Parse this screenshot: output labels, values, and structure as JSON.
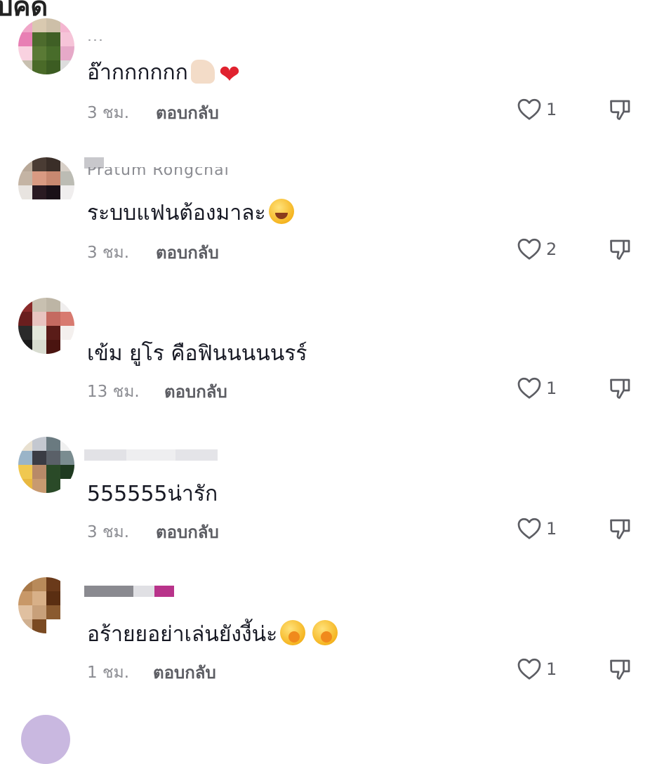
{
  "header": {
    "partial_title": "ปคิด"
  },
  "comments": [
    {
      "username": "...",
      "text": "อ๊ากกกกกก",
      "emojis": [
        "thumbs-up",
        "red-heart"
      ],
      "time": "3 ชม.",
      "reply": "ตอบกลับ",
      "likes": "1"
    },
    {
      "username": "Pratum Rongchai",
      "text": "ระบบแฟนต้องมาละ",
      "emojis": [
        "grinning-sweat"
      ],
      "time": "3 ชม.",
      "reply": "ตอบกลับ",
      "likes": "2"
    },
    {
      "username": "",
      "text": "เข้ม ยูโร คือฟินนนนนรร์",
      "emojis": [],
      "time": "13 ชม.",
      "reply": "ตอบกลับ",
      "likes": "1"
    },
    {
      "username": "",
      "text": "555555น่ารัก",
      "emojis": [],
      "time": "3 ชม.",
      "reply": "ตอบกลับ",
      "likes": "1"
    },
    {
      "username": "",
      "text": "อร้ายยอย่าเล่นยังงี้น่ะ",
      "emojis": [
        "hand-over-mouth",
        "hand-over-mouth"
      ],
      "time": "1 ชม.",
      "reply": "ตอบกลับ",
      "likes": "1"
    }
  ],
  "colors": {
    "primary_text": "#161823",
    "secondary_text": "#8a8b91",
    "icon": "#5c5d63",
    "heart_emoji": "#e0222f"
  }
}
